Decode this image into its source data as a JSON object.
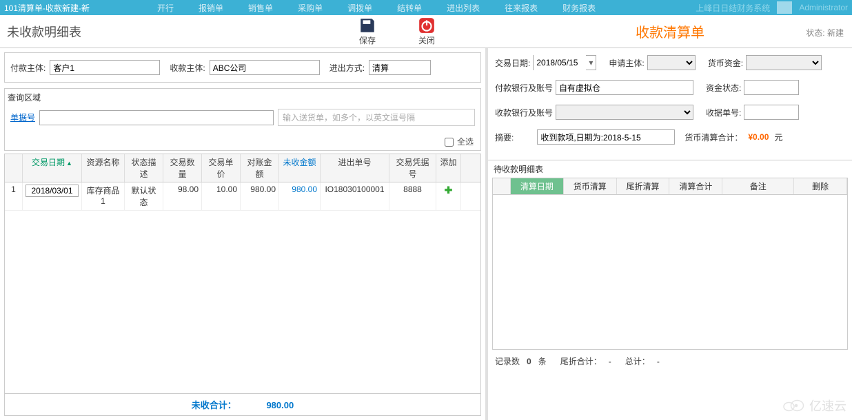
{
  "topbar": {
    "title": "101清算单-收款新建-新",
    "nav": [
      "开行",
      "报销单",
      "销售单",
      "采购单",
      "调拨单",
      "结转单",
      "进出列表",
      "往来报表",
      "财务报表"
    ],
    "brand": "上峰日日结财务系统",
    "user": "Administrator"
  },
  "header": {
    "left_title": "未收款明细表",
    "save": "保存",
    "close": "关闭",
    "right_title": "收款清算单",
    "status_label": "状态:",
    "status_value": "新建"
  },
  "left_form": {
    "payer_label": "付款主体:",
    "payer_value": "客户1",
    "payee_label": "收款主体:",
    "payee_value": "ABC公司",
    "inout_label": "进出方式:",
    "inout_value": "清算"
  },
  "query": {
    "section_title": "查询区域",
    "doc_link": "单据号",
    "hint": "输入送货单，如多个，以英文逗号隔",
    "select_all": "全选"
  },
  "grid": {
    "cols": [
      "",
      "交易日期",
      "资源名称",
      "状态描述",
      "交易数量",
      "交易单价",
      "对账金额",
      "未收金额",
      "进出单号",
      "交易凭据号",
      "添加"
    ],
    "row": {
      "idx": "1",
      "date": "2018/03/01",
      "res": "库存商品1",
      "status": "默认状态",
      "qty": "98.00",
      "price": "10.00",
      "amt": "980.00",
      "unpaid": "980.00",
      "io_no": "IO18030100001",
      "voucher": "8888"
    },
    "foot_label": "未收合计：",
    "foot_value": "980.00"
  },
  "rform": {
    "trade_date_label": "交易日期:",
    "trade_date_value": "2018/05/15",
    "applicant_label": "申请主体:",
    "currency_fund_label": "货币资金:",
    "pay_bank_label": "付款银行及账号",
    "pay_bank_value": "自有虚拟仓",
    "fund_status_label": "资金状态:",
    "recv_bank_label": "收款银行及账号",
    "receipt_no_label": "收据单号:",
    "summary_label": "摘要:",
    "summary_value": "收到款项,日期为:2018-5-15",
    "currency_total_label": "货币清算合计：",
    "currency_total_value": "¥0.00",
    "currency_unit": "元"
  },
  "subgrid": {
    "title": "待收款明细表",
    "cols": [
      "",
      "清算日期",
      "货币清算",
      "尾折清算",
      "清算合计",
      "备注",
      "删除"
    ]
  },
  "subfoot": {
    "records_label": "记录数",
    "records_value": "0",
    "records_unit": "条",
    "tail_label": "尾折合计：",
    "tail_value": "-",
    "total_label": "总计：",
    "total_value": "-"
  },
  "watermark": "亿速云"
}
